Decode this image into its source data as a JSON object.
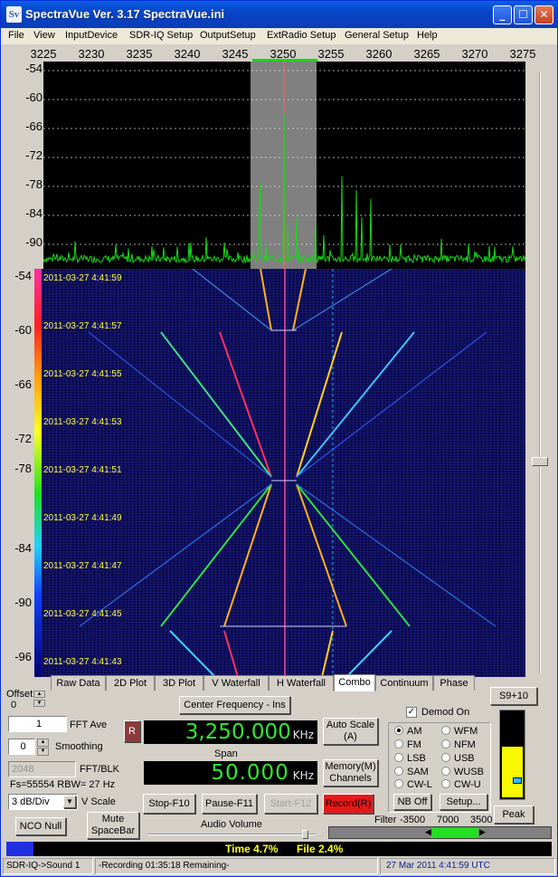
{
  "window": {
    "title": "SpectraVue Ver. 3.17  SpectraVue.ini",
    "icon": "Sv"
  },
  "menu": [
    "File",
    "View",
    "InputDevice",
    "SDR-IQ Setup",
    "OutputSetup",
    "ExtRadio Setup",
    "General Setup",
    "Help"
  ],
  "freq_axis": [
    "3225",
    "3230",
    "3235",
    "3240",
    "3245",
    "3250",
    "3255",
    "3260",
    "3265",
    "3270",
    "3275"
  ],
  "spectrum_db_axis": [
    "-54",
    "-60",
    "-66",
    "-72",
    "-78",
    "-84",
    "-90"
  ],
  "waterfall_db_axis": [
    "-54",
    "-60",
    "-66",
    "-72",
    "-78",
    "-84",
    "-90",
    "-96"
  ],
  "timestamps": [
    "2011-03-27 4:41:59",
    "2011-03-27 4:41:57",
    "2011-03-27 4:41:55",
    "2011-03-27 4:41:53",
    "2011-03-27 4:41:51",
    "2011-03-27 4:41:49",
    "2011-03-27 4:41:47",
    "2011-03-27 4:41:45",
    "2011-03-27 4:41:43"
  ],
  "tabs": [
    "Raw Data",
    "2D Plot",
    "3D Plot",
    "V Waterfall",
    "H Waterfall",
    "Combo",
    "Continuum",
    "Phase"
  ],
  "selected_tab": "Combo",
  "controls": {
    "offset_label": "Offset",
    "offset_value": "0",
    "fft_ave_value": "1",
    "fft_ave_label": "FFT Ave",
    "smoothing_value": "0",
    "smoothing_label": "Smoothing",
    "fft_blk_value": "2048",
    "fft_blk_label": "FFT/BLK",
    "fs_text": "Fs=55554 RBW=  27 Hz",
    "vscale_value": "3 dB/Div",
    "vscale_label": "V Scale",
    "nco_null": "NCO Null",
    "mute_line1": "Mute",
    "mute_line2": "SpaceBar",
    "center_freq_button": "Center Frequency - Ins",
    "r_button": "R",
    "center_freq": "3,250.000",
    "center_unit": "KHz",
    "span_label": "Span",
    "span_value": "50.000",
    "span_unit": "KHz",
    "auto_scale_line1": "Auto Scale",
    "auto_scale_line2": "(A)",
    "memory_line1": "Memory(M)",
    "memory_line2": "Channels",
    "stop": "Stop-F10",
    "pause": "Pause-F11",
    "start": "Start-F12",
    "record": "Record(R)",
    "audio_volume": "Audio Volume",
    "demod_on": "Demod On",
    "s9_button": "S9+10",
    "modes": [
      "AM",
      "FM",
      "LSB",
      "SAM",
      "CW-L",
      "WFM",
      "NFM",
      "USB",
      "WUSB",
      "CW-U"
    ],
    "selected_mode": "AM",
    "nb_off": "NB Off",
    "setup": "Setup...",
    "peak": "Peak",
    "filter_label": "Filter",
    "filter_low": "-3500",
    "filter_width": "7000",
    "filter_high": "3500"
  },
  "progress": {
    "time_text": "Time 4.7%",
    "file_text": "File 2.4%",
    "time_fraction": 0.047
  },
  "status": {
    "left": "SDR-IQ->Sound 1",
    "middle": "-Recording 01:35:18 Remaining-",
    "right": "27 Mar 2011   4:41:59 UTC"
  },
  "colors": {
    "title_bar": "#0a3cb8",
    "trace": "#19d619",
    "lcd_text": "#34e534",
    "record_button": "#e81818",
    "waterfall_bg": "#0a0a4c"
  }
}
